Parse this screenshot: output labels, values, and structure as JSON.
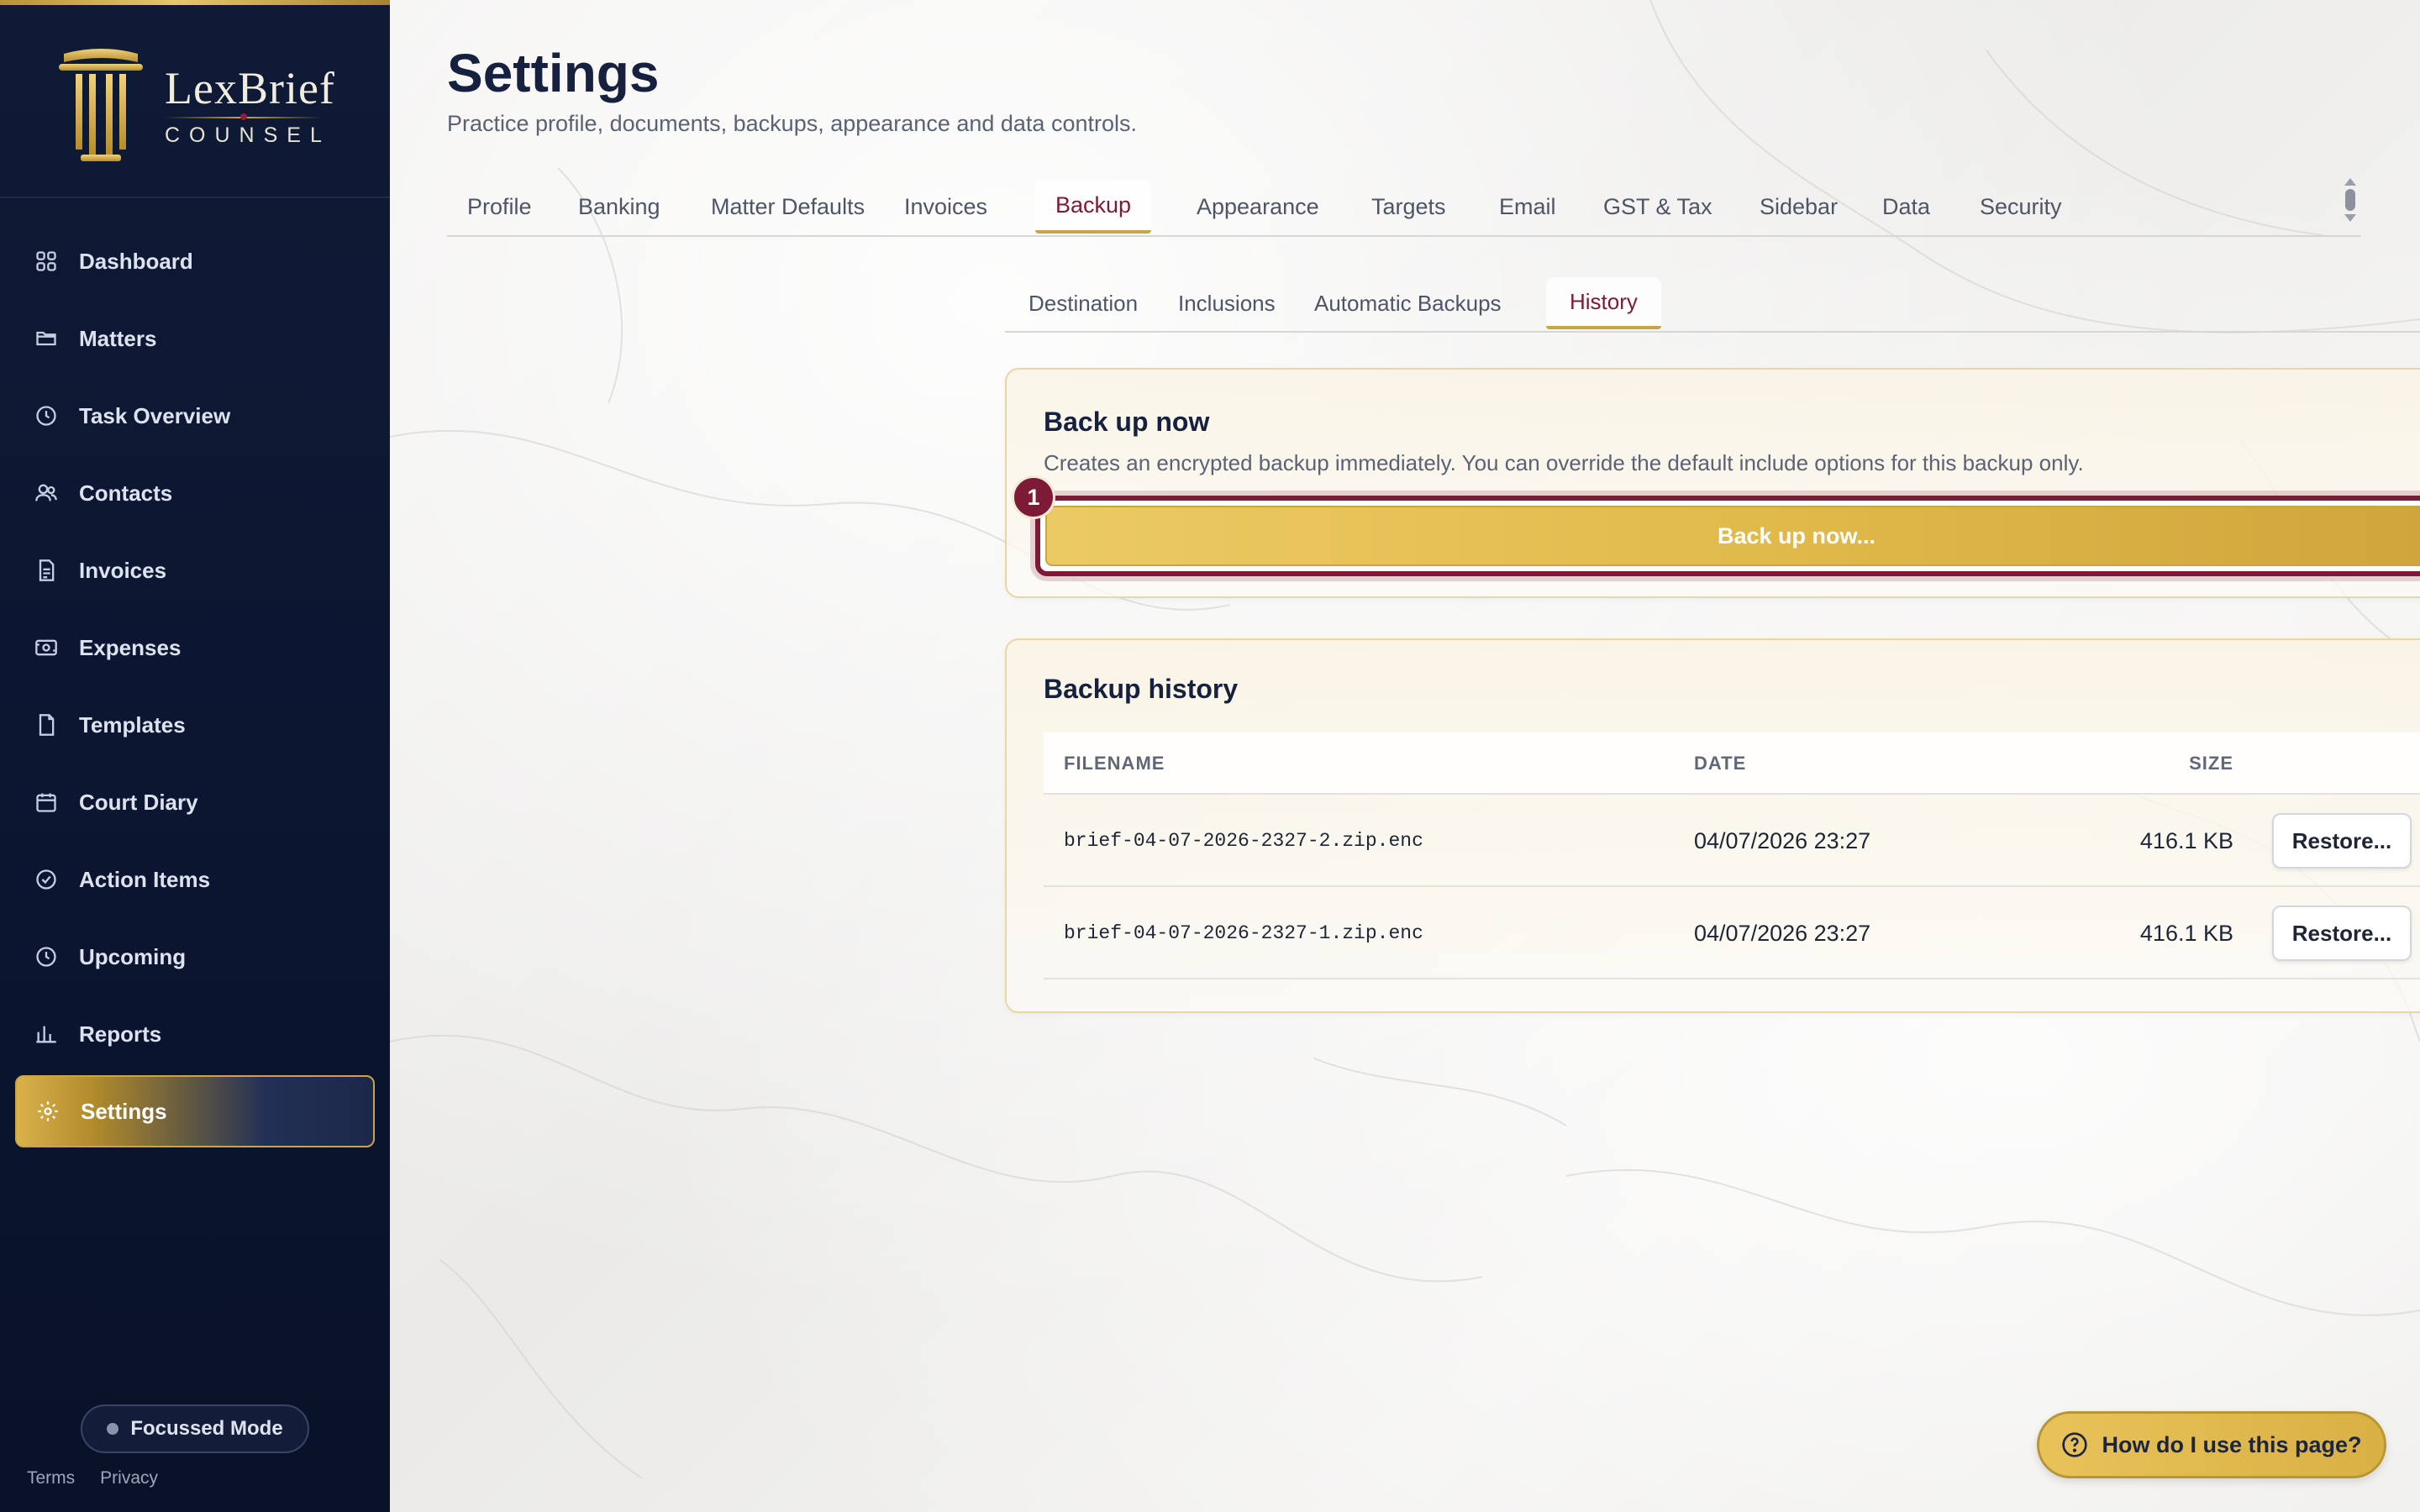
{
  "brand": {
    "name": "LexBrief",
    "subtitle": "COUNSEL"
  },
  "sidebar": {
    "items": [
      {
        "label": "Dashboard",
        "icon": "grid-icon"
      },
      {
        "label": "Matters",
        "icon": "folder-icon"
      },
      {
        "label": "Task Overview",
        "icon": "clock-icon"
      },
      {
        "label": "Contacts",
        "icon": "users-icon"
      },
      {
        "label": "Invoices",
        "icon": "invoice-icon"
      },
      {
        "label": "Expenses",
        "icon": "cash-icon"
      },
      {
        "label": "Templates",
        "icon": "file-icon"
      },
      {
        "label": "Court Diary",
        "icon": "calendar-icon"
      },
      {
        "label": "Action Items",
        "icon": "check-circle-icon"
      },
      {
        "label": "Upcoming",
        "icon": "clock-icon"
      },
      {
        "label": "Reports",
        "icon": "bar-chart-icon"
      },
      {
        "label": "Settings",
        "icon": "gear-icon",
        "active": true
      }
    ],
    "focus_mode": "Focussed Mode",
    "footer": {
      "terms": "Terms",
      "privacy": "Privacy"
    }
  },
  "page": {
    "title": "Settings",
    "subtitle": "Practice profile, documents, backups, appearance and data controls."
  },
  "tabs": [
    "Profile",
    "Banking",
    "Matter Defaults",
    "Invoices",
    "Backup",
    "Appearance",
    "Targets",
    "Email",
    "GST & Tax",
    "Sidebar",
    "Data",
    "Security"
  ],
  "active_tab": "Backup",
  "subtabs": [
    "Destination",
    "Inclusions",
    "Automatic Backups",
    "History"
  ],
  "active_subtab": "History",
  "backup_now": {
    "title": "Back up now",
    "description": "Creates an encrypted backup immediately. You can override the default include options for this backup only.",
    "button_label": "Back up now...",
    "badge": "1"
  },
  "history": {
    "title": "Backup history",
    "columns": {
      "filename": "FILENAME",
      "date": "DATE",
      "size": "SIZE"
    },
    "rows": [
      {
        "filename": "brief-04-07-2026-2327-2.zip.enc",
        "date": "04/07/2026 23:27",
        "size": "416.1 KB",
        "action": "Restore..."
      },
      {
        "filename": "brief-04-07-2026-2327-1.zip.enc",
        "date": "04/07/2026 23:27",
        "size": "416.1 KB",
        "action": "Restore..."
      }
    ]
  },
  "help": {
    "label": "How do I use this page?"
  },
  "colors": {
    "navy": "#0f1a36",
    "gold": "#c9a548",
    "burgundy": "#7d1a36"
  }
}
